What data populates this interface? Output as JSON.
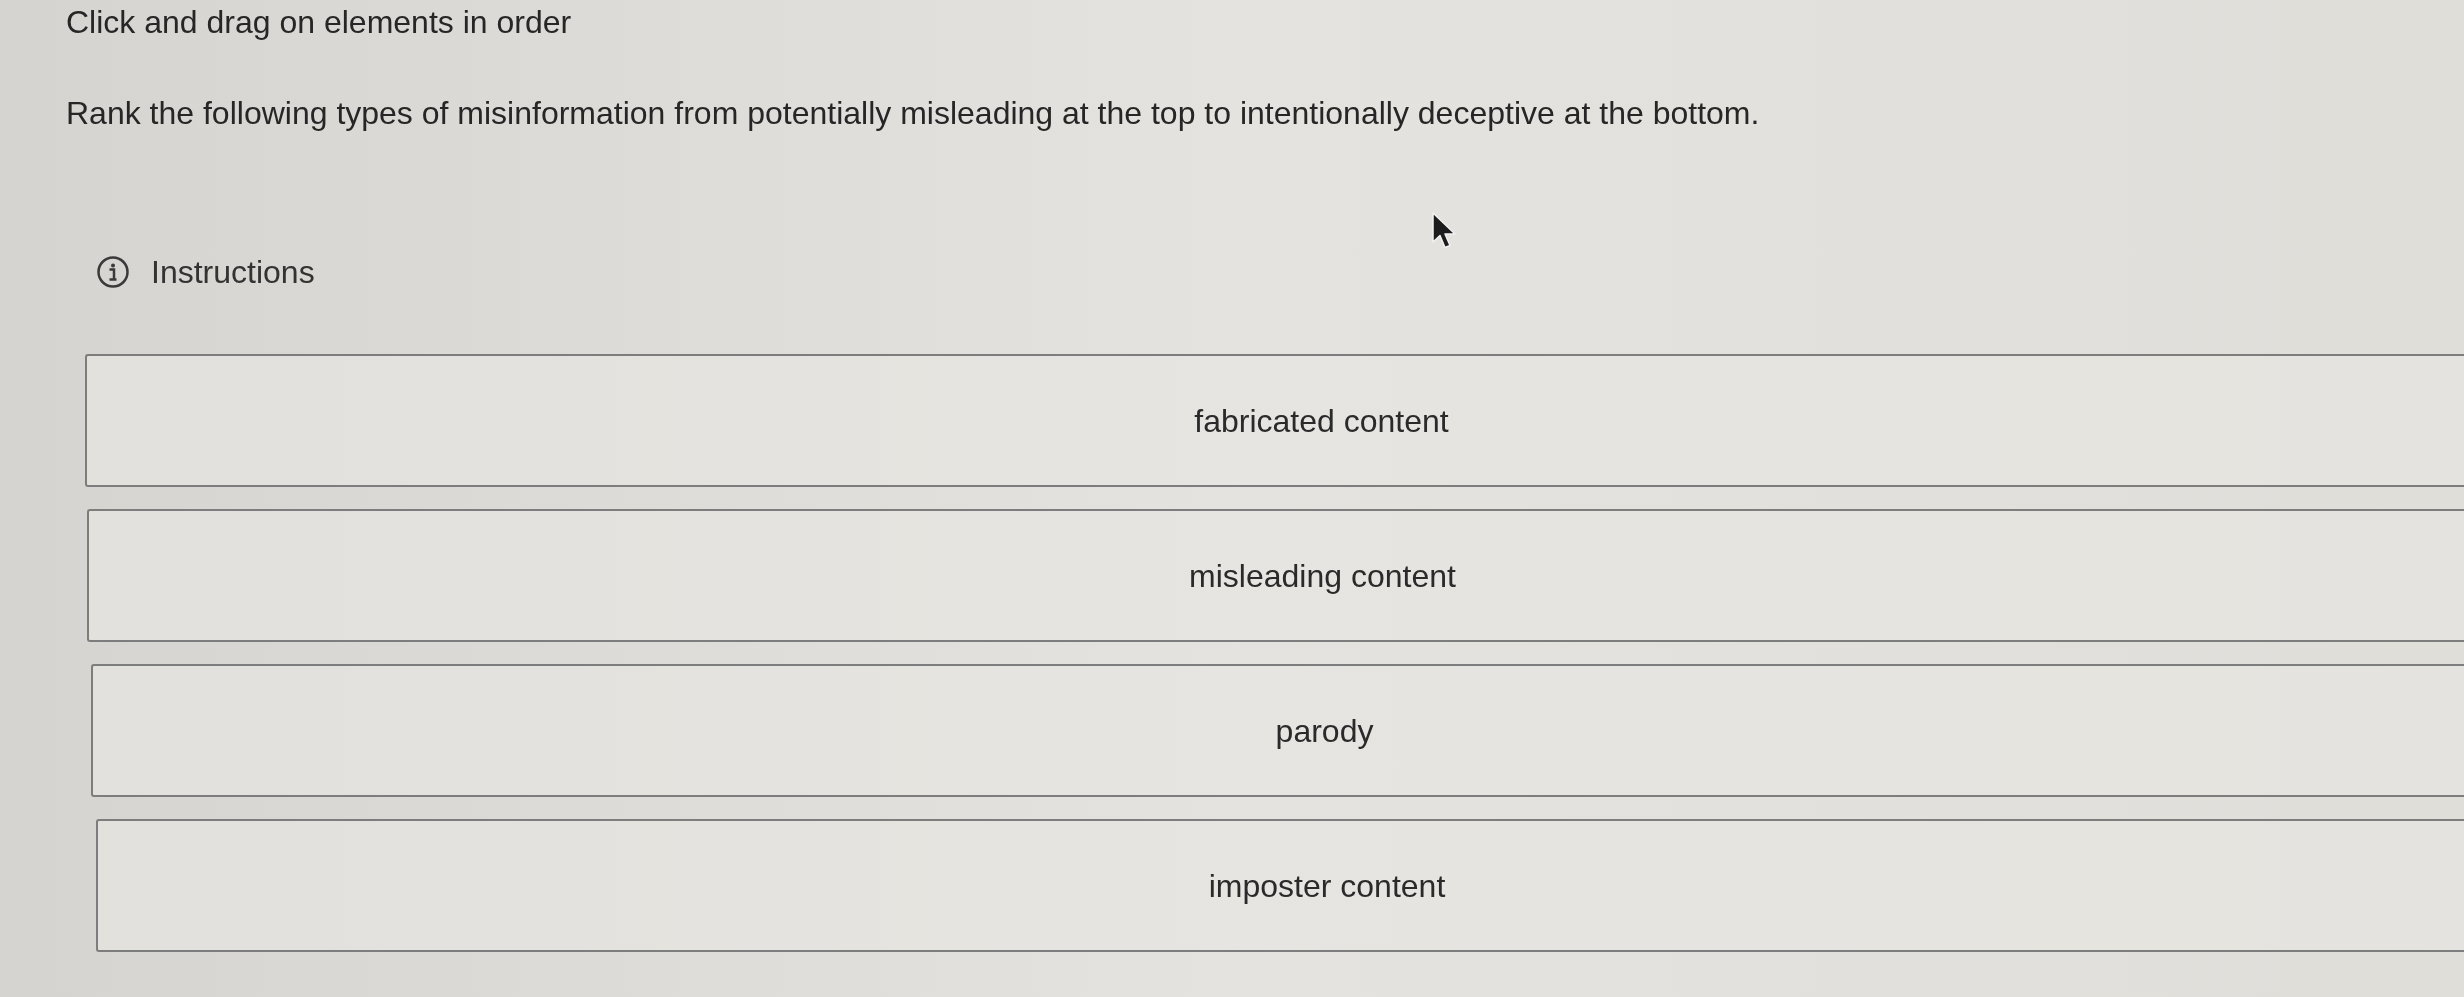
{
  "prompt": {
    "title": "Click and drag on elements in order",
    "question": "Rank the following types of misinformation from potentially misleading at the top to intentionally deceptive at the bottom.",
    "instructions": "Instructions"
  },
  "items": [
    {
      "label": "fabricated content"
    },
    {
      "label": "misleading content"
    },
    {
      "label": "parody"
    },
    {
      "label": "imposter content"
    }
  ]
}
